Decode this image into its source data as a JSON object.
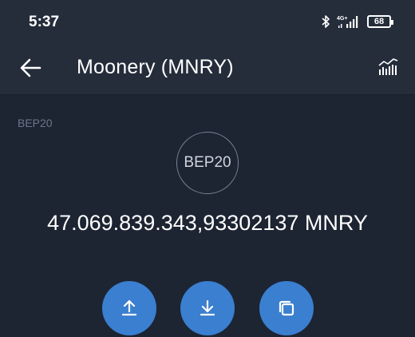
{
  "status_bar": {
    "time": "5:37",
    "network": "4G+",
    "battery_level": "68",
    "icons": [
      "bluetooth-icon",
      "signal-icon",
      "battery-icon"
    ]
  },
  "header": {
    "title": "Moonery (MNRY)",
    "back_icon": "arrow-left-icon",
    "chart_icon": "chart-icon"
  },
  "token": {
    "network_label": "BEP20",
    "logo_text": "BEP20",
    "balance": "47.069.839.343,93302137 MNRY"
  },
  "actions": [
    {
      "icon": "send-icon"
    },
    {
      "icon": "receive-icon"
    },
    {
      "icon": "copy-icon"
    }
  ],
  "colors": {
    "background": "#1d2432",
    "header": "#252d3b",
    "accent": "#3a7fd0",
    "muted_text": "#6c778a"
  }
}
